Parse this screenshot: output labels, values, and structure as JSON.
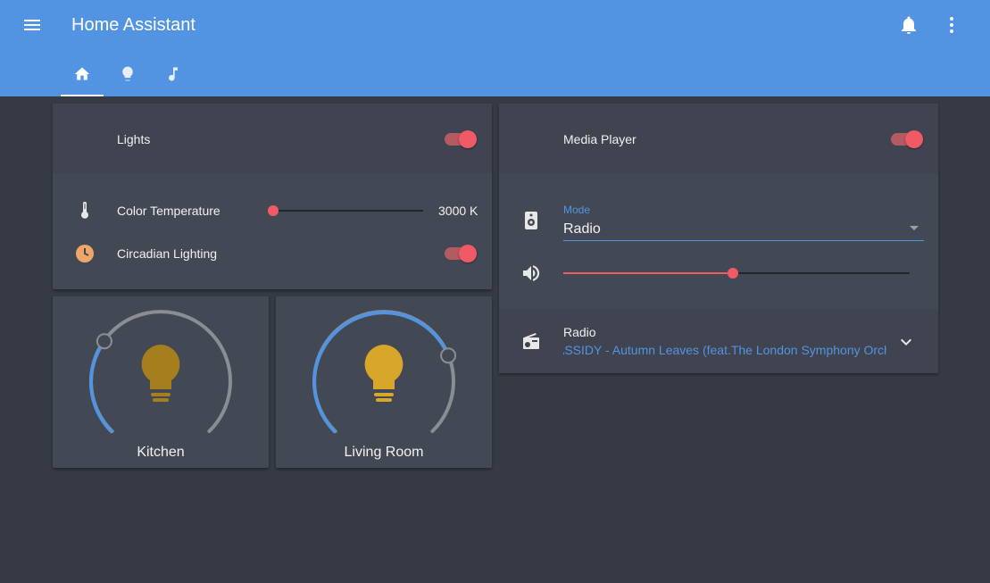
{
  "app": {
    "title": "Home Assistant"
  },
  "toolbar": {
    "menu_icon": "menu-icon",
    "notifications_icon": "bell-icon",
    "more_icon": "dots-vertical-icon"
  },
  "tabs": [
    {
      "icon": "home-icon",
      "active": true
    },
    {
      "icon": "lightbulb-icon",
      "active": false
    },
    {
      "icon": "music-note-icon",
      "active": false
    }
  ],
  "lights_card": {
    "title": "Lights",
    "toggle_on": true,
    "color_temperature": {
      "label": "Color Temperature",
      "value": "3000 K",
      "slider_fraction": 0.0,
      "icon": "thermometer-icon"
    },
    "circadian": {
      "label": "Circadian Lighting",
      "toggle_on": true,
      "icon": "clock-icon"
    }
  },
  "lights": [
    {
      "name": "Kitchen",
      "level": 0.3,
      "bulb_color": "#a57f1e"
    },
    {
      "name": "Living Room",
      "level": 0.75,
      "bulb_color": "#d8a62a"
    }
  ],
  "media_card": {
    "title": "Media Player",
    "toggle_on": true,
    "mode_label": "Mode",
    "mode_value": "Radio",
    "volume_fraction": 0.49,
    "speaker_icon": "speaker-icon",
    "volume_icon": "volume-high-icon",
    "source_icon": "radio-icon",
    "now_playing_title": "Radio",
    "now_playing_track": "ASSIDY - Autumn Leaves (feat.The London Symphony Orchestra)",
    "expand_icon": "chevron-down-icon"
  },
  "colors": {
    "header": "#5294e2",
    "accent": "#ef5a65",
    "background": "#363a44",
    "card": "#434954"
  }
}
